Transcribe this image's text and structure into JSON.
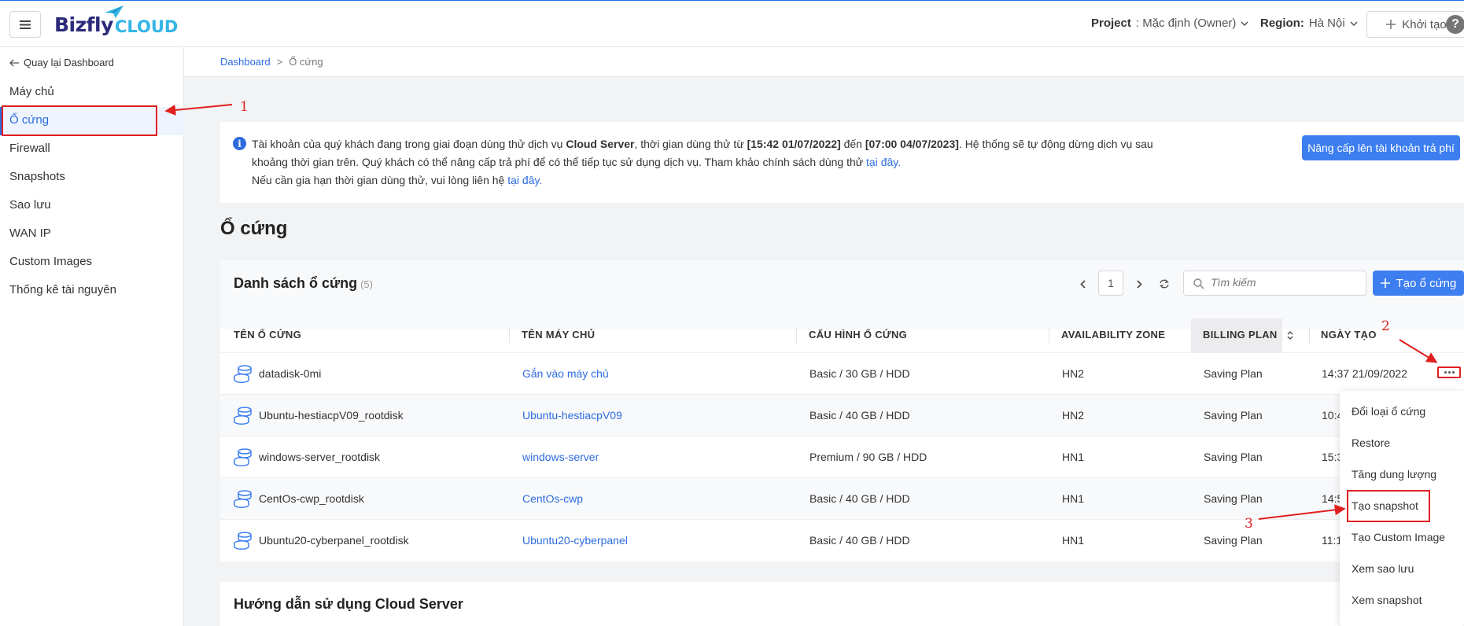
{
  "header": {
    "logo_main": "Bizfly",
    "logo_sub": "CLOUD",
    "project_label": "Project",
    "project_value": ": Mặc định (Owner)",
    "region_label": "Region:",
    "region_value": "Hà Nội",
    "create_label": "Khởi tạo",
    "help_label": "?"
  },
  "sidebar": {
    "back_label": "Quay lại Dashboard",
    "items": [
      {
        "label": "Máy chủ",
        "active": false
      },
      {
        "label": "Ổ cứng",
        "active": true
      },
      {
        "label": "Firewall",
        "active": false
      },
      {
        "label": "Snapshots",
        "active": false
      },
      {
        "label": "Sao lưu",
        "active": false
      },
      {
        "label": "WAN IP",
        "active": false
      },
      {
        "label": "Custom Images",
        "active": false
      },
      {
        "label": "Thống kê tài nguyên",
        "active": false
      }
    ]
  },
  "breadcrumb": {
    "root": "Dashboard",
    "separator": ">",
    "current": "Ổ cứng"
  },
  "notice": {
    "line1_a": "Tài khoản của quý khách đang trong giai đoạn dùng thử dịch vụ ",
    "line1_service": "Cloud Server",
    "line1_b": ", thời gian dùng thử từ ",
    "line1_start": "[15:42 01/07/2022]",
    "line1_c": " đến ",
    "line1_end": "[07:00 04/07/2023]",
    "line1_d": ". Hệ thống sẽ tự động dừng dịch vụ sau khoảng thời gian trên. Quý khách có thể nâng cấp trả phí để có thể tiếp tục sử dụng dịch vụ. Tham khảo chính sách dùng thử ",
    "link1": "tại đây.",
    "line2": "Nếu cần gia hạn thời gian dùng thử, vui lòng liên hệ ",
    "link2": "tại đây.",
    "upgrade_label": "Nâng cấp lên tài khoản trả phí"
  },
  "page_title": "Ổ cứng",
  "list": {
    "title": "Danh sách ổ cứng",
    "count": "(5)",
    "page": "1",
    "search_placeholder": "Tìm kiếm",
    "add_label": "Tạo ổ cứng",
    "columns": [
      "TÊN Ổ CỨNG",
      "TÊN MÁY CHỦ",
      "CẤU HÌNH Ổ CỨNG",
      "AVAILABILITY ZONE",
      "BILLING PLAN",
      "NGÀY TẠO"
    ],
    "rows": [
      {
        "name": "datadisk-0mi",
        "server": "Gắn vào máy chủ",
        "config": "Basic / 30 GB / HDD",
        "zone": "HN2",
        "billing": "Saving Plan",
        "created": "14:37 21/09/2022"
      },
      {
        "name": "Ubuntu-hestiacpV09_rootdisk",
        "server": "Ubuntu-hestiacpV09",
        "config": "Basic / 40 GB / HDD",
        "zone": "HN2",
        "billing": "Saving Plan",
        "created": "10:4"
      },
      {
        "name": "windows-server_rootdisk",
        "server": "windows-server",
        "config": "Premium / 90 GB / HDD",
        "zone": "HN1",
        "billing": "Saving Plan",
        "created": "15:3"
      },
      {
        "name": "CentOs-cwp_rootdisk",
        "server": "CentOs-cwp",
        "config": "Basic / 40 GB / HDD",
        "zone": "HN1",
        "billing": "Saving Plan",
        "created": "14:5"
      },
      {
        "name": "Ubuntu20-cyberpanel_rootdisk",
        "server": "Ubuntu20-cyberpanel",
        "config": "Basic / 40 GB / HDD",
        "zone": "HN1",
        "billing": "Saving Plan",
        "created": "11:1"
      }
    ]
  },
  "dropdown": [
    "Đổi loại ổ cứng",
    "Restore",
    "Tăng dung lượng",
    "Tạo snapshot",
    "Tạo Custom Image",
    "Xem sao lưu",
    "Xem snapshot"
  ],
  "guide_title": "Hướng dẫn sử dụng Cloud Server",
  "annotations": [
    "1",
    "2",
    "3"
  ],
  "colors": {
    "accent": "#3d7ff0",
    "link": "#2d6cdf",
    "annotation": "#e02020"
  }
}
